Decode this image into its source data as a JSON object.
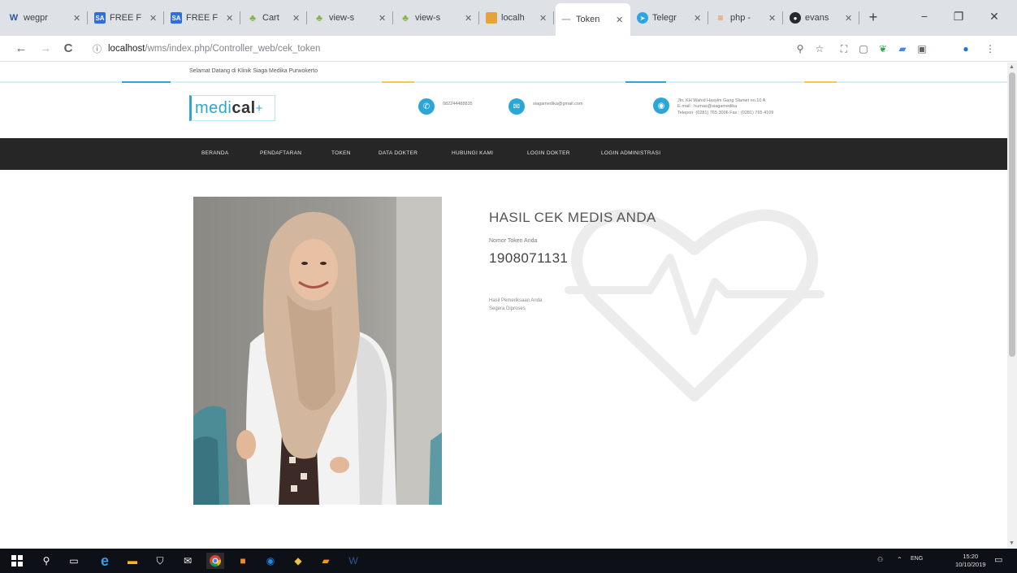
{
  "browser": {
    "tabs": [
      {
        "label": "wegpr",
        "icon": "word-icon",
        "color": "#2b579a"
      },
      {
        "label": "FREE F",
        "icon": "sa-icon",
        "color": "#2f6fd8"
      },
      {
        "label": "FREE F",
        "icon": "sa-icon",
        "color": "#2f6fd8"
      },
      {
        "label": "Cart",
        "icon": "themeforest-icon",
        "color": "#82b440"
      },
      {
        "label": "view-s",
        "icon": "themeforest-icon",
        "color": "#82b440"
      },
      {
        "label": "view-s",
        "icon": "themeforest-icon",
        "color": "#82b440"
      },
      {
        "label": "localh",
        "icon": "localhost-icon",
        "color": "#e6a23c"
      },
      {
        "label": "Token",
        "icon": "loading-icon",
        "color": "#9aa0a6"
      },
      {
        "label": "Telegr",
        "icon": "telegram-icon",
        "color": "#2ca5e0"
      },
      {
        "label": "php -",
        "icon": "stackoverflow-icon",
        "color": "#f48024"
      },
      {
        "label": "evans",
        "icon": "github-icon",
        "color": "#24292e"
      }
    ],
    "url_host": "localhost",
    "url_path": "/wms/index.php/Controller_web/cek_token",
    "new_tab": "+",
    "minimize": "−",
    "maximize": "❐",
    "close": "✕",
    "back": "←",
    "forward": "→",
    "reload": "C",
    "info": "ⓘ"
  },
  "site": {
    "greeting": "Selamat Datang di Klinik Siaga Medika Purwokerto",
    "brand": {
      "part1": "medi",
      "part2": "cal",
      "part3": "+"
    },
    "contacts": {
      "phone": "082244488835",
      "email": "siagamedika@gmail.com",
      "address": [
        "Jln. KH Wahid Hasyim Gang Slamet no.10 A",
        "E-mail : humas@siagamedika",
        "Telepon: (0281) 765 3006 Fax : (0281) 765 4109"
      ]
    },
    "nav": [
      "BERANDA",
      "PENDAFTARAN",
      "TOKEN",
      "DATA DOKTER",
      "HUBUNGI KAMI",
      "LOGIN DOKTER",
      "LOGIN ADMINISTRASI"
    ]
  },
  "result": {
    "title": "HASIL CEK MEDIS ANDA",
    "token_label": "Nomor Token Anda",
    "token_value": "1908071131",
    "result_label": "Hasil Pemeriksaan Anda",
    "result_value": "Segera Diproses"
  },
  "taskbar": {
    "lang": "ENG",
    "time": "15:20",
    "date": "10/10/2019"
  },
  "colors": {
    "accent": "#2ba6d7",
    "nav_bg": "#262626",
    "accent_yellow": "#f2c94c"
  }
}
